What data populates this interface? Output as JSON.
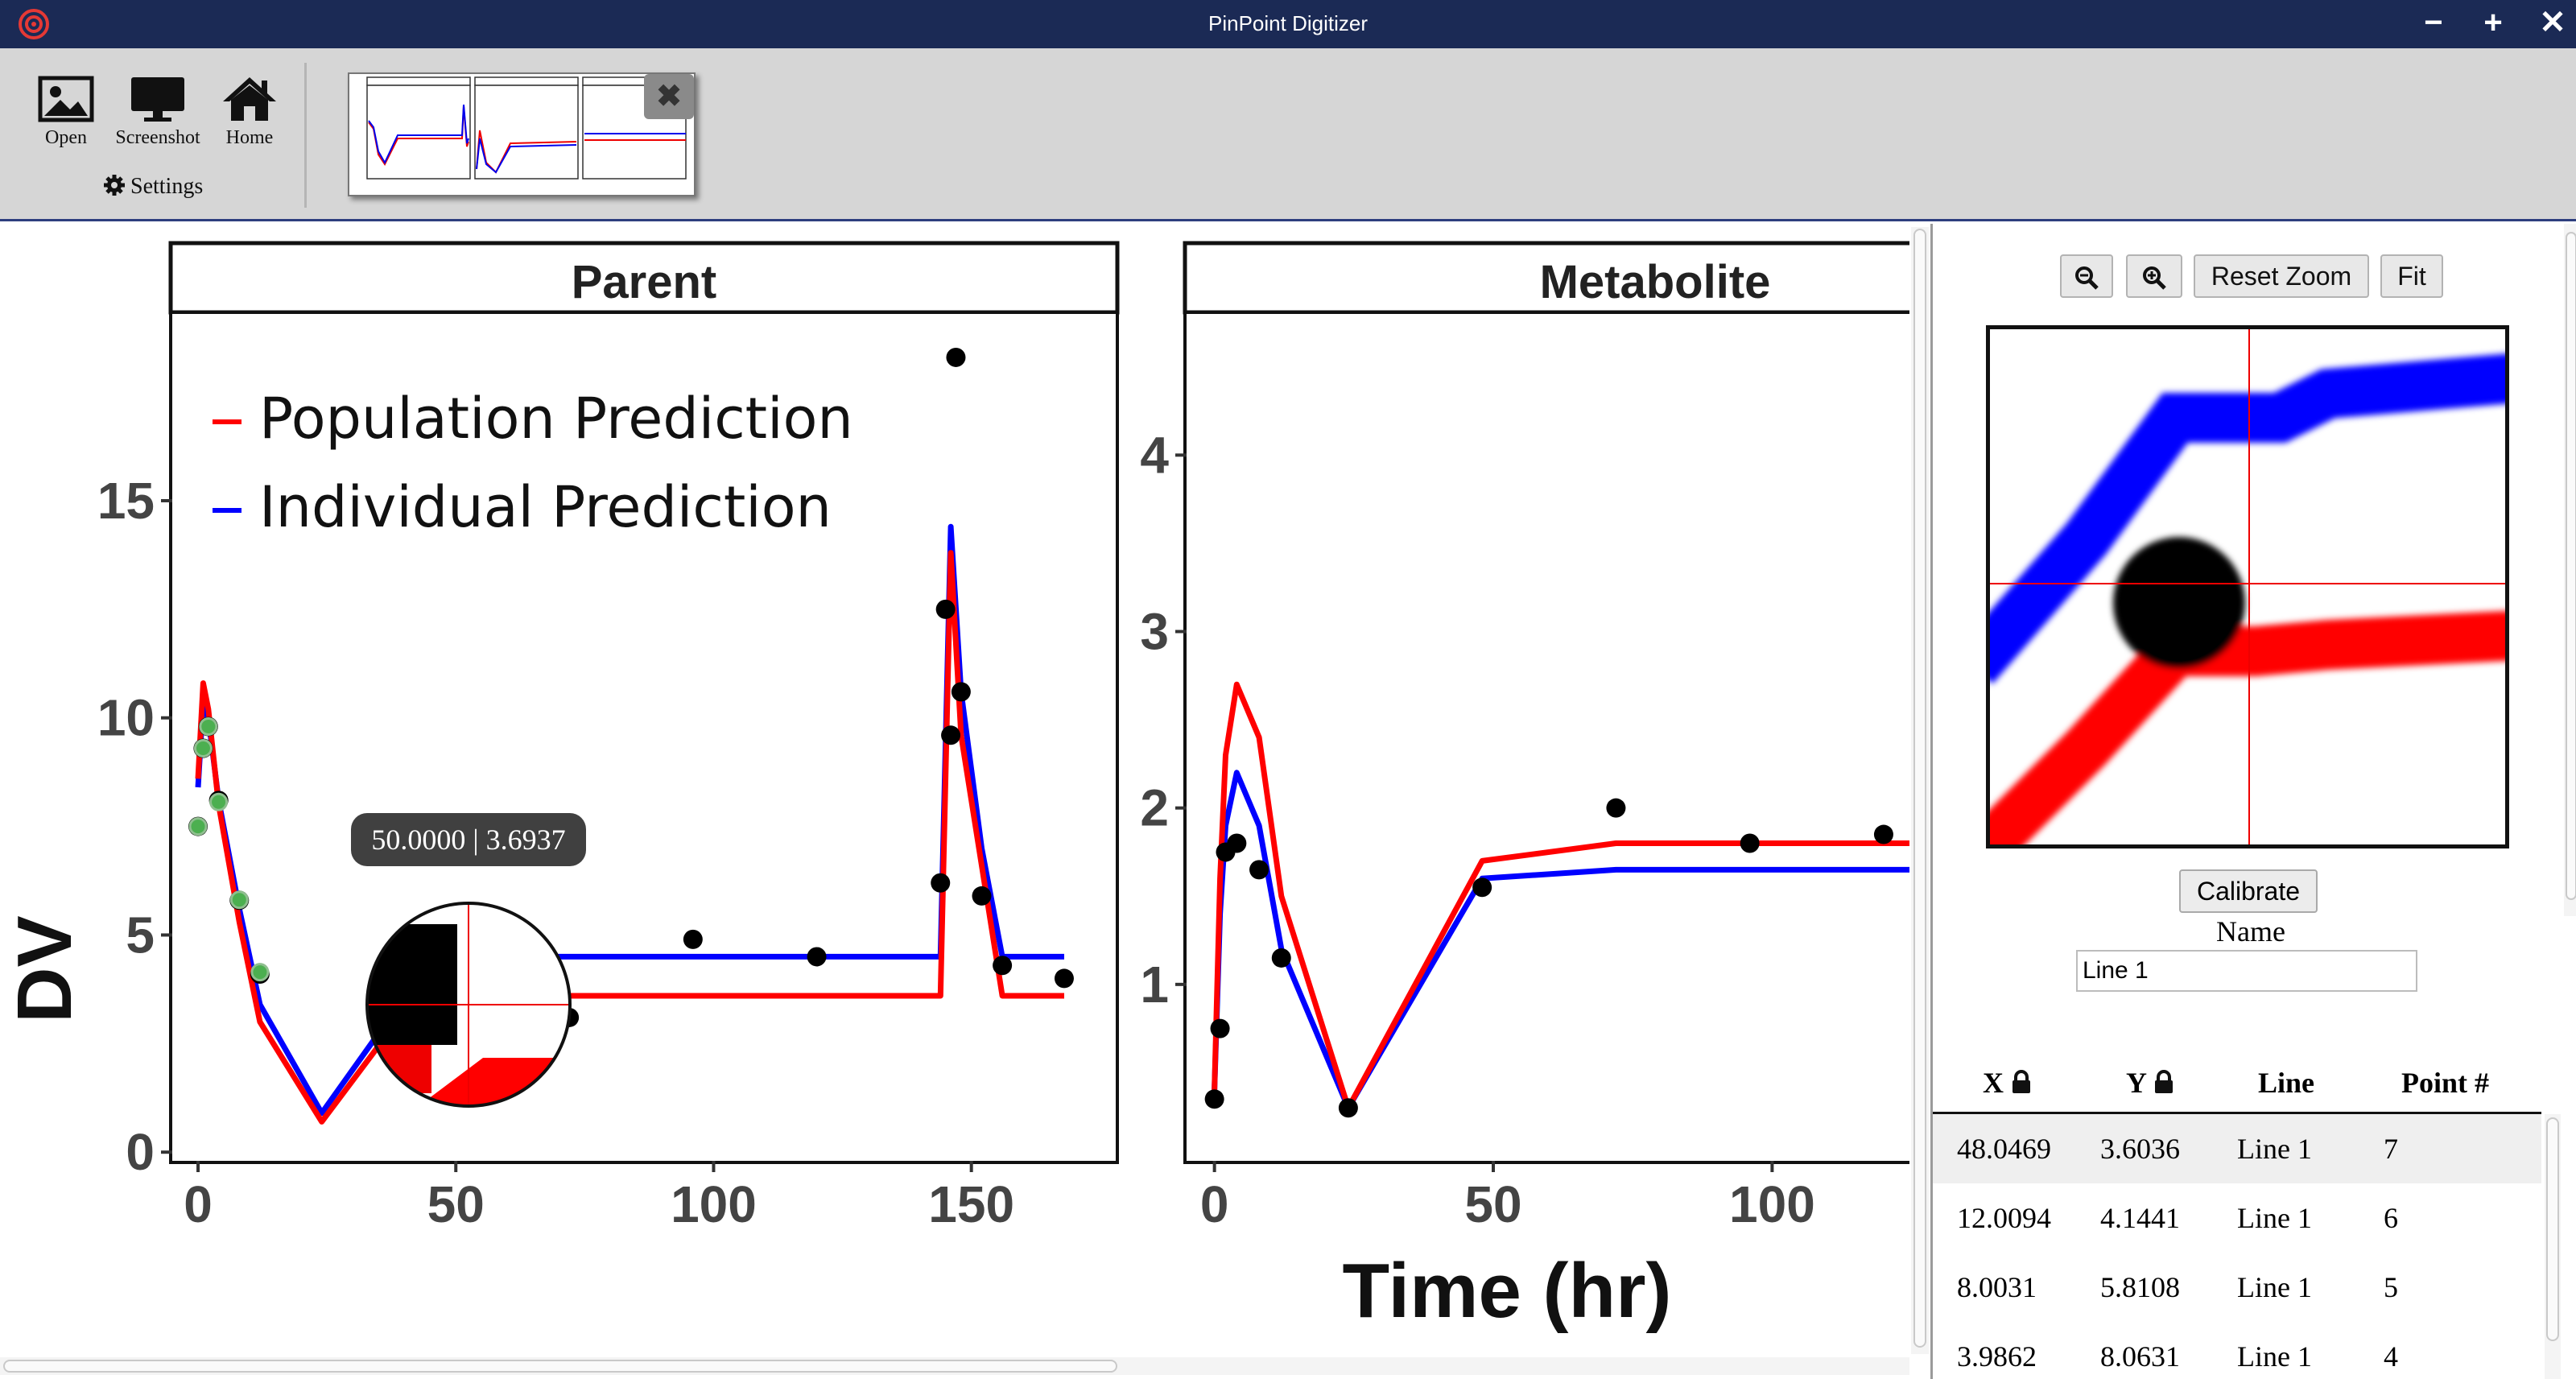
{
  "window": {
    "title": "PinPoint Digitizer",
    "controls": [
      "−",
      "+",
      "✕"
    ]
  },
  "toolbar": {
    "open_label": "Open",
    "screenshot_label": "Screenshot",
    "home_label": "Home",
    "settings_label": "Settings"
  },
  "tooltip": {
    "text": "50.0000 | 3.6937"
  },
  "zoom_controls": {
    "reset_label": "Reset Zoom",
    "fit_label": "Fit"
  },
  "panel": {
    "calibrate_label": "Calibrate",
    "name_label": "Name",
    "name_value": "Line 1"
  },
  "table": {
    "headers": {
      "x": "X",
      "y": "Y",
      "line": "Line",
      "point": "Point #"
    },
    "rows": [
      {
        "x": "48.0469",
        "y": "3.6036",
        "line": "Line 1",
        "point": "7"
      },
      {
        "x": "12.0094",
        "y": "4.1441",
        "line": "Line 1",
        "point": "6"
      },
      {
        "x": "8.0031",
        "y": "5.8108",
        "line": "Line 1",
        "point": "5"
      },
      {
        "x": "3.9862",
        "y": "8.0631",
        "line": "Line 1",
        "point": "4"
      }
    ]
  },
  "colors": {
    "title_bar": "#1b2a55",
    "toolbar_bg": "#d6d6d6",
    "population_line": "#ff0000",
    "individual_line": "#0000ff",
    "digitized_point": "#4caf50",
    "observed_point": "#000000"
  },
  "chart_data": [
    {
      "type": "line",
      "title": "Parent",
      "ylabel": "DV",
      "xlabel": "",
      "xlim": [
        -5,
        178
      ],
      "ylim": [
        -0.2,
        19.3
      ],
      "x_ticks": [
        "0",
        "50",
        "100",
        "150"
      ],
      "x_tick_values": [
        0,
        50,
        100,
        150
      ],
      "y_ticks": [
        "0",
        "5",
        "10",
        "15"
      ],
      "y_tick_values": [
        0,
        5,
        10,
        15
      ],
      "legend": [
        "Population Prediction",
        "Individual Prediction"
      ],
      "legend_position": "top-left",
      "series": [
        {
          "name": "Population Prediction",
          "color": "#ff0000",
          "x": [
            0,
            1,
            2,
            4,
            8,
            12,
            24,
            36,
            48,
            72,
            96,
            120,
            144,
            146,
            148,
            152,
            156,
            168
          ],
          "y": [
            8.6,
            10.8,
            10.2,
            8.0,
            5.3,
            3.0,
            0.7,
            2.6,
            3.6,
            3.6,
            3.6,
            3.6,
            3.6,
            13.8,
            9.6,
            6.6,
            3.6,
            3.6
          ]
        },
        {
          "name": "Individual Prediction",
          "color": "#0000ff",
          "x": [
            0,
            1,
            2,
            4,
            8,
            12,
            24,
            36,
            48,
            72,
            96,
            120,
            144,
            146,
            148,
            152,
            156,
            168
          ],
          "y": [
            8.4,
            10.4,
            10.0,
            8.1,
            5.6,
            3.4,
            0.9,
            2.9,
            4.5,
            4.5,
            4.5,
            4.5,
            4.5,
            14.4,
            10.6,
            7.0,
            4.5,
            4.5
          ]
        }
      ],
      "observations": {
        "x": [
          0,
          1,
          2,
          4,
          8,
          12,
          72,
          96,
          120,
          144,
          145,
          146,
          147,
          148,
          152,
          156,
          168
        ],
        "y": [
          7.5,
          9.3,
          9.8,
          8.1,
          5.8,
          4.1,
          3.1,
          4.9,
          4.5,
          6.2,
          12.5,
          9.6,
          18.3,
          10.6,
          5.9,
          4.3,
          4.0
        ]
      },
      "digitized_points": {
        "x": [
          0,
          1,
          2,
          3.9862,
          8.0031,
          12.0094
        ],
        "y": [
          7.5,
          9.3,
          9.8,
          8.0631,
          5.8108,
          4.1441
        ]
      }
    },
    {
      "type": "line",
      "title": "Metabolite",
      "xlabel": "Time (hr)",
      "ylabel": "",
      "xlim": [
        -5,
        133
      ],
      "ylim": [
        0.0,
        4.8
      ],
      "x_ticks": [
        "0",
        "50",
        "100"
      ],
      "x_tick_values": [
        0,
        50,
        100
      ],
      "y_ticks": [
        "1",
        "2",
        "3",
        "4"
      ],
      "y_tick_values": [
        1,
        2,
        3,
        4
      ],
      "series": [
        {
          "name": "Population Prediction",
          "color": "#ff0000",
          "x": [
            0,
            1,
            2,
            4,
            8,
            12,
            24,
            48,
            72,
            96,
            120,
            133
          ],
          "y": [
            0.4,
            1.6,
            2.3,
            2.7,
            2.4,
            1.5,
            0.3,
            1.7,
            1.8,
            1.8,
            1.8,
            1.8
          ]
        },
        {
          "name": "Individual Prediction",
          "color": "#0000ff",
          "x": [
            0,
            1,
            2,
            4,
            8,
            12,
            24,
            48,
            72,
            96,
            120,
            133
          ],
          "y": [
            0.4,
            1.4,
            1.9,
            2.2,
            1.9,
            1.2,
            0.3,
            1.6,
            1.65,
            1.65,
            1.65,
            1.65
          ]
        }
      ],
      "observations": {
        "x": [
          0,
          1,
          2,
          4,
          8,
          12,
          24,
          48,
          72,
          96,
          120
        ],
        "y": [
          0.35,
          0.75,
          1.75,
          1.8,
          1.65,
          1.15,
          0.3,
          1.55,
          2.0,
          1.8,
          1.85
        ]
      }
    }
  ]
}
